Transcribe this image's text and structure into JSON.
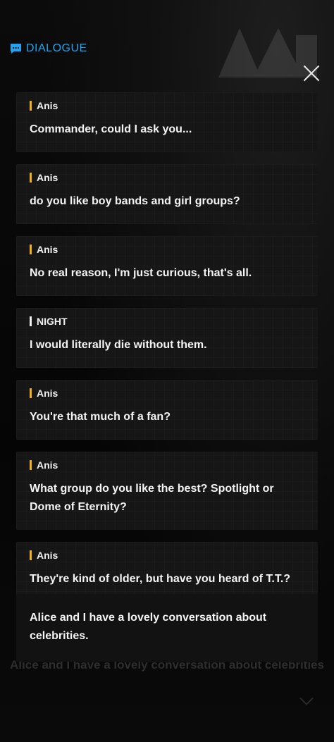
{
  "header": {
    "title": "DIALOGUE",
    "icon": "speech-bubble-icon",
    "accent_color": "#1ea4f0"
  },
  "close": {
    "icon": "close-icon"
  },
  "entries": [
    {
      "speaker": "Anis",
      "text": "Commander, could I ask you..."
    },
    {
      "speaker": "Anis",
      "text": "do you like boy bands and girl groups?"
    },
    {
      "speaker": "Anis",
      "text": "No real reason, I'm just curious, that's all."
    },
    {
      "speaker": "NIGHT",
      "text": "I would literally die without them."
    },
    {
      "speaker": "Anis",
      "text": "You're that much of a fan?"
    },
    {
      "speaker": "Anis",
      "text": "What group do you like the best? Spotlight or Dome of Eternity?"
    },
    {
      "speaker": "Anis",
      "text": "They're kind of older, but have you heard of T.T.?"
    }
  ],
  "narration": {
    "text": "Alice and I have a lovely conversation about celebrities."
  },
  "background": {
    "ghost_text": "Alice and I have a lovely conversation about celebrities"
  },
  "colors": {
    "npc_bar": "#f0b020",
    "player_bar": "#f0f0f0"
  }
}
